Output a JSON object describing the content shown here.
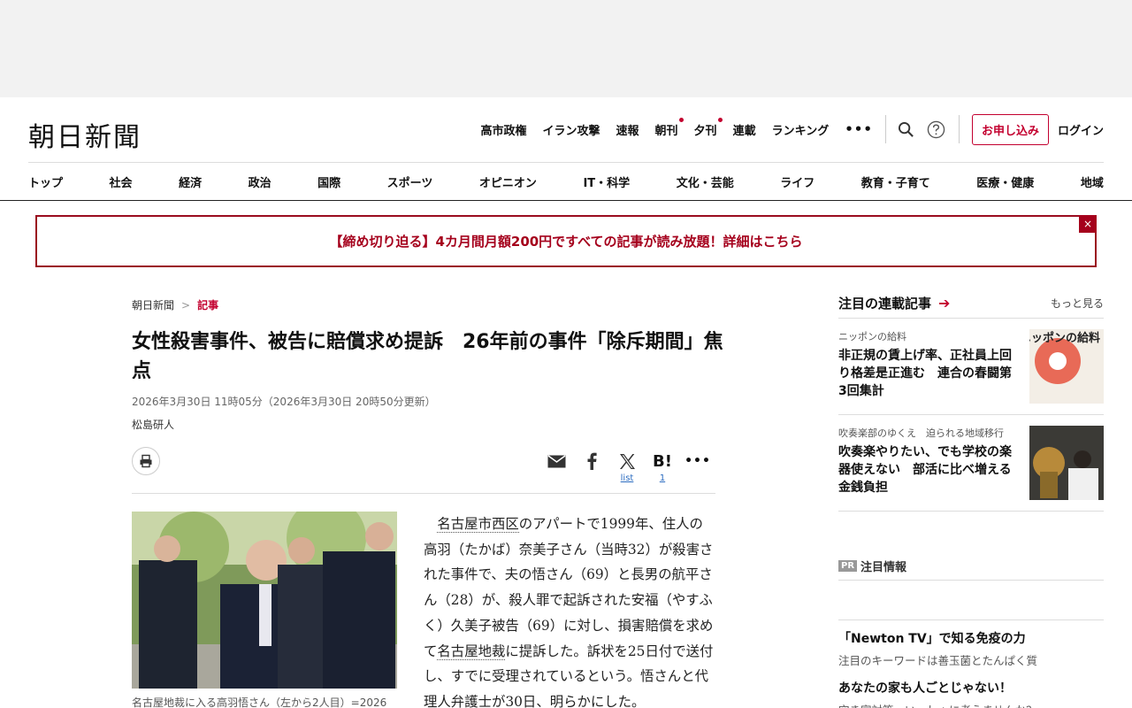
{
  "site": {
    "logo": "朝日新聞"
  },
  "topnav": {
    "links": [
      "高市政権",
      "イラン攻撃",
      "速報",
      "朝刊",
      "夕刊",
      "連載",
      "ランキング"
    ],
    "more": "•••",
    "subscribe": "お申し込み",
    "login": "ログイン"
  },
  "catnav": [
    "トップ",
    "社会",
    "経済",
    "政治",
    "国際",
    "スポーツ",
    "オピニオン",
    "IT・科学",
    "文化・芸能",
    "ライフ",
    "教育・子育て",
    "医療・健康",
    "地域"
  ],
  "promo": {
    "text": "【締め切り迫る】4カ月間月額200円ですべての記事が読み放題！詳細はこちら",
    "close": "×"
  },
  "breadcrumb": {
    "home": "朝日新聞",
    "sep": ">",
    "current": "記事"
  },
  "article": {
    "title": "女性殺害事件、被告に賠償求め提訴　26年前の事件「除斥期間」焦点",
    "dateline": "2026年3月30日 11時05分（2026年3月30日 20時50分更新）",
    "author": "松島研人",
    "share": {
      "x_count": "list",
      "hatena_count": "1"
    },
    "caption": "名古屋地裁に入る高羽悟さん（左から2人目）=2026",
    "body_link1": "名古屋市西区",
    "body_part1": "のアパートで1999年、住人の高羽（たかば）奈美子さん（当時32）が殺害された事件で、夫の悟さん（69）と長男の航平さん（28）が、殺人罪で起訴された安福（やすふく）久美子被告（69）に対し、損害賠償を求めて",
    "body_link2": "名古屋地裁",
    "body_part2": "に提訴した。訴状を25日付で送付し、すでに受理されているという。悟さんと代理人弁護士が30日、明らかにした。"
  },
  "sidebar": {
    "title": "注目の連載記事",
    "more": "もっと見る",
    "serials": [
      {
        "kicker": "ニッポンの給料",
        "title": "非正規の賃上げ率、正社員上回り格差是正進む　連合の春闘第3回集計",
        "thumb_text": "ニッポンの給料"
      },
      {
        "kicker": "吹奏楽部のゆくえ　迫られる地域移行",
        "title": "吹奏楽やりたい、でも学校の楽器使えない　部活に比べ増える金銭負担"
      }
    ],
    "pr_badge": "PR",
    "pr_title": "注目情報",
    "pr_items": [
      {
        "title": "「Newton TV」で知る免疫の力",
        "sub": "注目のキーワードは善玉菌とたんぱく質"
      },
      {
        "title": "あなたの家も人ごとじゃない！",
        "sub": "空き家対策、いっしょに考えませんか？"
      }
    ]
  }
}
